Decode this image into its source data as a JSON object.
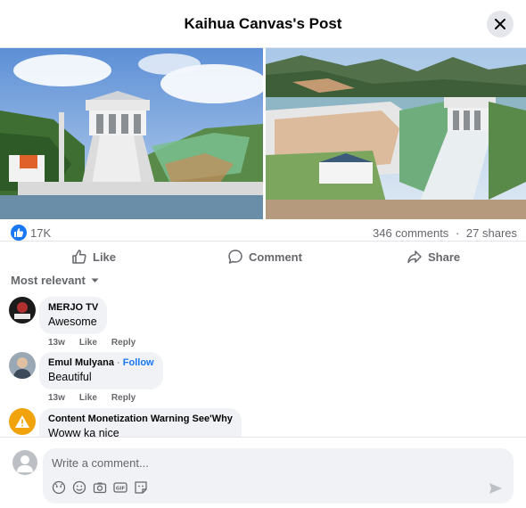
{
  "header": {
    "title": "Kaihua Canvas's Post"
  },
  "photos": [
    {
      "alt": "Dam spillway front view"
    },
    {
      "alt": "Dam and reservoir aerial view"
    }
  ],
  "stats": {
    "reactions": "17K",
    "comments": "346 comments",
    "separator": "·",
    "shares": "27 shares"
  },
  "actions": {
    "like": "Like",
    "comment": "Comment",
    "share": "Share"
  },
  "sort": {
    "label": "Most relevant"
  },
  "comments": [
    {
      "author": "MERJO TV",
      "text": "Awesome",
      "time": "13w",
      "like": "Like",
      "reply": "Reply"
    },
    {
      "author": "Emul Mulyana",
      "follow": "Follow",
      "text": "Beautiful",
      "time": "13w",
      "like": "Like",
      "reply": "Reply"
    },
    {
      "author": "Content Monetization Warning See'Why",
      "text": "Woww ka nice"
    }
  ],
  "composer": {
    "placeholder": "Write a comment..."
  },
  "icons": {
    "close": "close-icon",
    "like_badge": "thumbs-up-icon",
    "like": "thumbs-up-icon",
    "comment": "comment-bubble-icon",
    "share": "share-arrow-icon",
    "sort": "caret-down-icon",
    "avatar_tool": "avatar-icon",
    "emoji": "emoji-icon",
    "camera": "camera-icon",
    "gif": "gif-icon",
    "sticker": "sticker-icon",
    "send": "send-icon"
  },
  "colors": {
    "accent": "#1877f2",
    "text": "#050505",
    "secondary": "#65676b",
    "bubble": "#f0f2f5"
  }
}
